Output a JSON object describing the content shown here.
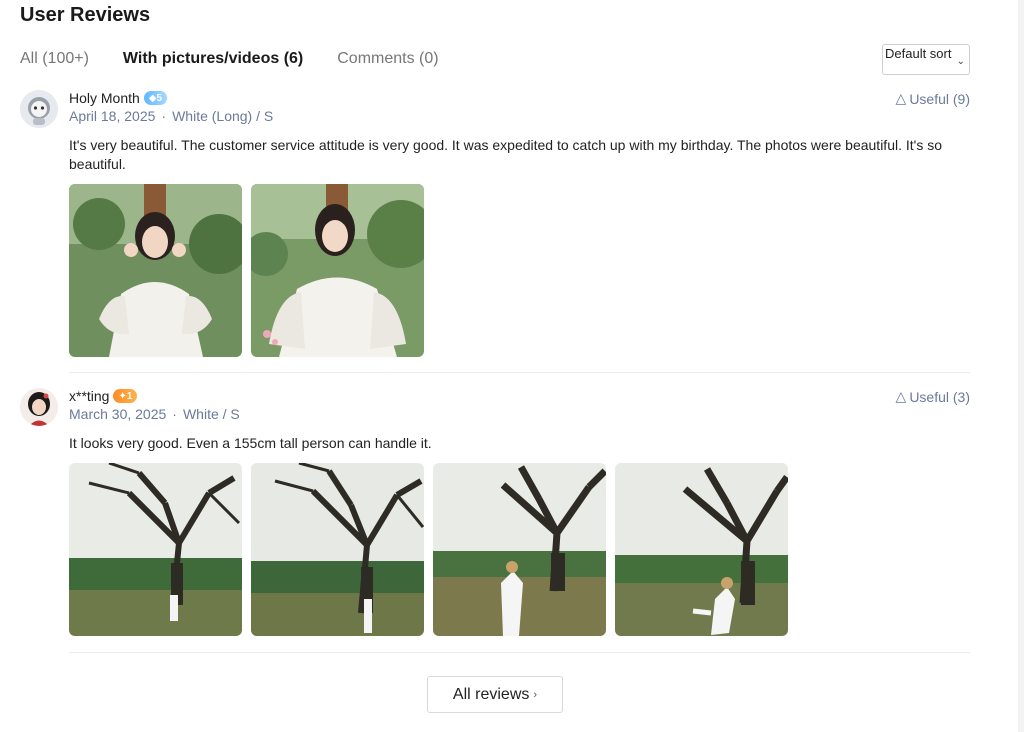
{
  "header": {
    "title": "User Reviews"
  },
  "tabs": [
    {
      "label": "All (100+)"
    },
    {
      "label": "With pictures/videos (6)"
    },
    {
      "label": "Comments (0)"
    }
  ],
  "sort": {
    "selected": "Default sort"
  },
  "reviews": [
    {
      "username": "Holy Month",
      "badge": "5",
      "date": "April 18, 2025",
      "variant": "White (Long) / S",
      "useful": "Useful (9)",
      "text": "It's very beautiful. The customer service attitude is very good. It was expedited to catch up with my birthday. The photos were beautiful. It's so beautiful.",
      "photos": [
        "portrait-photo",
        "portrait-photo"
      ]
    },
    {
      "username": "x**ting",
      "badge": "1",
      "date": "March 30, 2025",
      "variant": "White / S",
      "useful": "Useful (3)",
      "text": "It looks very good. Even a 155cm tall person can handle it.",
      "photos": [
        "tree-photo",
        "tree-photo",
        "tree-photo",
        "tree-photo"
      ]
    }
  ],
  "footer": {
    "all_reviews": "All reviews"
  },
  "colors": {
    "meta": "#6b7a99",
    "badge_blue": "#5fb7ff",
    "badge_orange": "#ff8a2b"
  }
}
